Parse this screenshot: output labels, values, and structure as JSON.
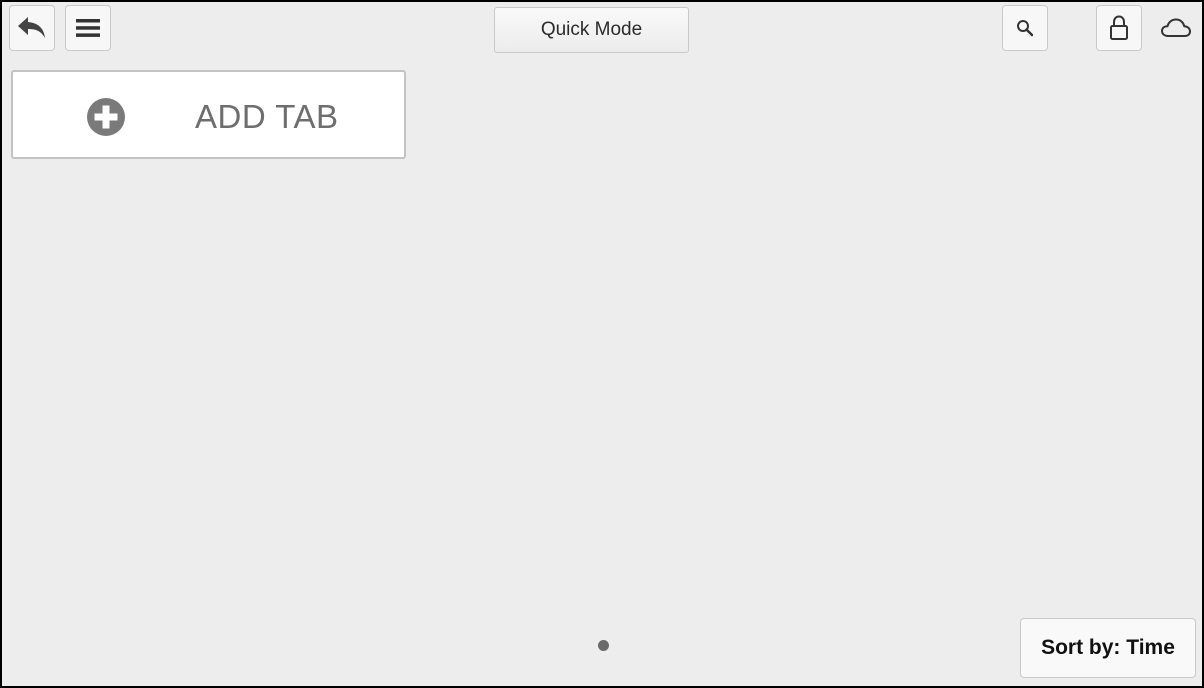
{
  "toolbar": {
    "back_icon": "undo-arrow-icon",
    "menu_icon": "hamburger-menu-icon",
    "mode_label": "Quick Mode",
    "search_icon": "magnifier-icon",
    "lock_icon": "padlock-icon",
    "cloud_icon": "cloud-icon"
  },
  "tabs": {
    "add_label": "ADD TAB",
    "add_icon": "plus-circle-icon"
  },
  "footer": {
    "sort_label": "Sort by: Time",
    "page_indicator_count": 1
  },
  "colors": {
    "background": "#ededed",
    "icon": "#444444",
    "plus_circle": "#7a7a7a",
    "add_tab_text": "#6e6e6e"
  }
}
